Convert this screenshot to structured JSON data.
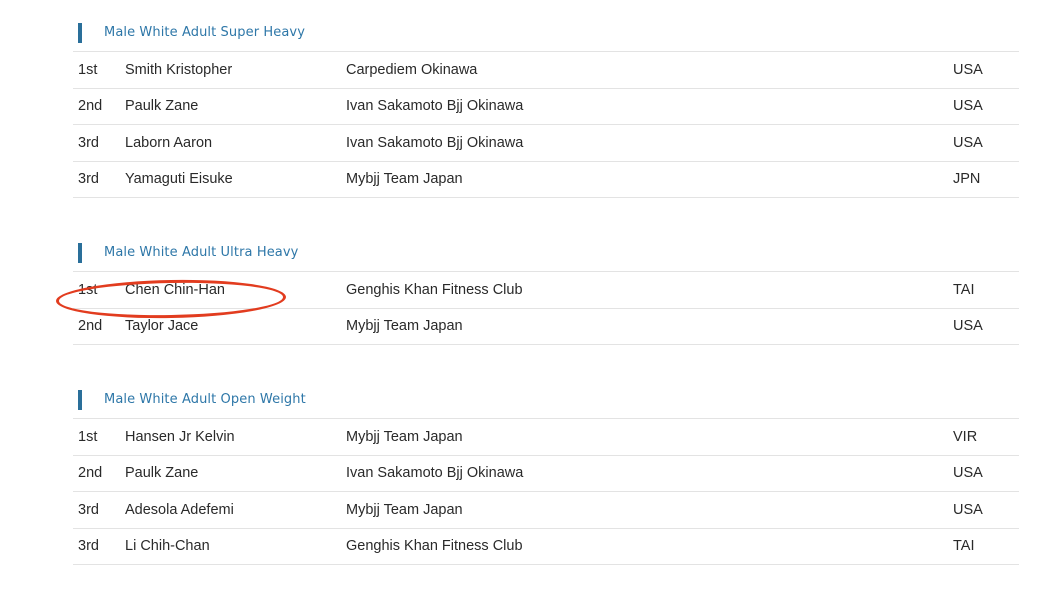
{
  "categories": [
    {
      "title": "Male White Adult Super Heavy",
      "rows": [
        {
          "place": "1st",
          "name": "Smith Kristopher",
          "team": "Carpediem Okinawa",
          "country": "USA"
        },
        {
          "place": "2nd",
          "name": "Paulk Zane",
          "team": "Ivan Sakamoto Bjj Okinawa",
          "country": "USA"
        },
        {
          "place": "3rd",
          "name": "Laborn Aaron",
          "team": "Ivan Sakamoto Bjj Okinawa",
          "country": "USA"
        },
        {
          "place": "3rd",
          "name": "Yamaguti Eisuke",
          "team": "Mybjj Team Japan",
          "country": "JPN"
        }
      ]
    },
    {
      "title": "Male White Adult Ultra Heavy",
      "rows": [
        {
          "place": "1st",
          "name": "Chen Chin-Han",
          "team": "Genghis Khan Fitness Club",
          "country": "TAI"
        },
        {
          "place": "2nd",
          "name": "Taylor Jace",
          "team": "Mybjj Team Japan",
          "country": "USA"
        }
      ]
    },
    {
      "title": "Male White Adult Open Weight",
      "rows": [
        {
          "place": "1st",
          "name": "Hansen Jr Kelvin",
          "team": "Mybjj Team Japan",
          "country": "VIR"
        },
        {
          "place": "2nd",
          "name": "Paulk Zane",
          "team": "Ivan Sakamoto Bjj Okinawa",
          "country": "USA"
        },
        {
          "place": "3rd",
          "name": "Adesola Adefemi",
          "team": "Mybjj Team Japan",
          "country": "USA"
        },
        {
          "place": "3rd",
          "name": "Li Chih-Chan",
          "team": "Genghis Khan Fitness Club",
          "country": "TAI"
        }
      ]
    }
  ],
  "colors": {
    "accent_bar": "#2a6f9a",
    "category_title": "#2e77a8",
    "highlight_annotation": "#e23c1f",
    "row_divider": "#e3e3e3"
  }
}
